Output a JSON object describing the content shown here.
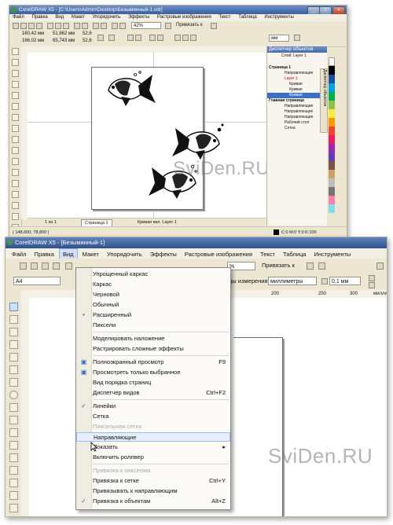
{
  "top_window": {
    "title": "CorelDRAW X5 - [C:\\Users\\Admin\\Desktop\\Безымянный-1.cdr]",
    "menu": [
      "Файл",
      "Правка",
      "Вид",
      "Макет",
      "Упорядочить",
      "Эффекты",
      "Растровые изображения",
      "Текст",
      "Таблица",
      "Инструменты"
    ],
    "zoom": "42%",
    "snap_label": "Привязать к",
    "units": "мм",
    "coords": {
      "x": "160,42 мм",
      "y": "166,02 мм",
      "w": "51,862 мм",
      "h": "65,743 мм"
    },
    "scale_w": "52,6",
    "scale_h": "52,6",
    "page_tab": "Страница 1",
    "page_counter": "1 из 1",
    "status_left": "( 148,600; 78,800 )",
    "status_mid": "Кривая вкл. Layer 1",
    "status_right": "C:0 M:0 Y:0 K:100",
    "docker_title": "Диспетчер объектов",
    "docker_layer": "Слой: Layer 1",
    "objects": [
      "Страница 1",
      "Направляющие",
      "Layer 1",
      "Кривая",
      "Кривая",
      "Кривая",
      "Главная страница",
      "Направляющие",
      "Направляющие",
      "Направляющие",
      "Рабочий стол",
      "Сетка"
    ],
    "docker_side_tabs": "Диспетчер объектов",
    "watermark": "SviDen.RU"
  },
  "bottom_window": {
    "title": "CorelDRAW X5 - [Безымянный-1]",
    "menu": [
      "Файл",
      "Правка",
      "Вид",
      "Макет",
      "Упорядочить",
      "Эффекты",
      "Растровые изображения",
      "Текст",
      "Таблица",
      "Инструменты"
    ],
    "zoom": "%",
    "snap_label": "Привязать к",
    "units_label": "цы измерения:",
    "units_value": "миллиметры",
    "nudge": "0,1 мм",
    "page_size": "A4",
    "ruler_ticks": [
      "200",
      "250",
      "300"
    ],
    "ruler_right": "миллиметры",
    "watermark": "SviDen.RU",
    "view_menu": [
      {
        "label": "Упрощенный каркас"
      },
      {
        "label": "Каркас"
      },
      {
        "label": "Черновой"
      },
      {
        "label": "Обычный"
      },
      {
        "label": "Расширенный"
      },
      {
        "label": "Пиксели"
      },
      {
        "label": "Моделировать наложение"
      },
      {
        "label": "Растрировать сложные эффекты"
      },
      {
        "label": "Полноэкранный просмотр",
        "shortcut": "F9"
      },
      {
        "label": "Просмотреть только выбранное"
      },
      {
        "label": "Вид порядка страниц"
      },
      {
        "label": "Диспетчер видов",
        "shortcut": "Ctrl+F2"
      },
      {
        "label": "Линейки"
      },
      {
        "label": "Сетка"
      },
      {
        "label": "Пиксельная сетка"
      },
      {
        "label": "Направляющие"
      },
      {
        "label": "Показать"
      },
      {
        "label": "Включить роллвер"
      },
      {
        "label": "Привязка к пикселям"
      },
      {
        "label": "Привязка к сетке",
        "shortcut": "Ctrl+Y"
      },
      {
        "label": "Привязывать к направляющим"
      },
      {
        "label": "Привязка к объектам",
        "shortcut": "Alt+Z"
      }
    ]
  },
  "colors": {
    "title_blue": "#3c5f9b",
    "chrome": "#ece6d2",
    "highlight": "#e6eefb",
    "accent": "#2c6bbf"
  }
}
